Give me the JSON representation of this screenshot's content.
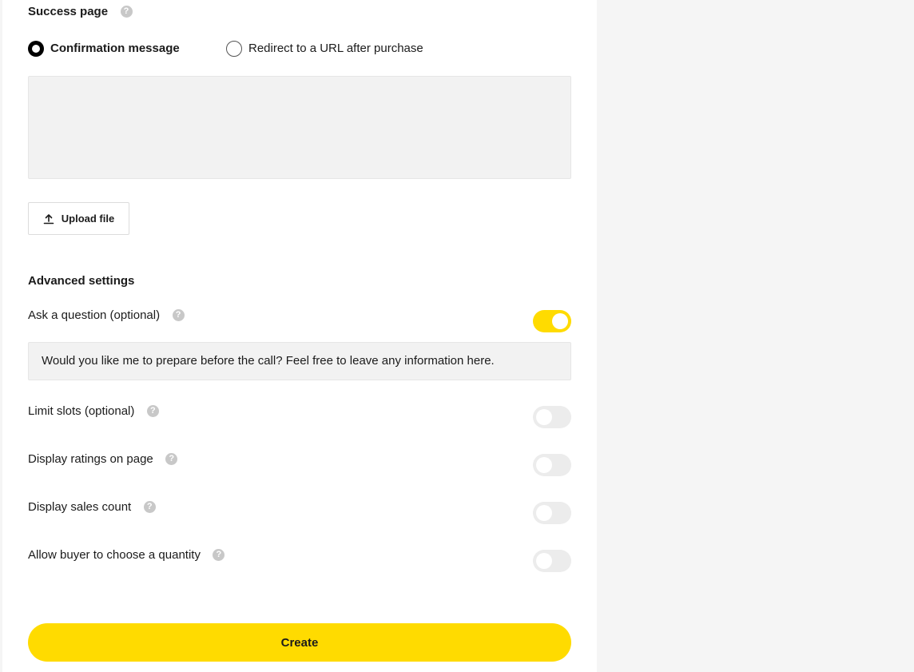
{
  "success_page": {
    "title": "Success page",
    "help_icon": "question-circle-icon",
    "options": [
      {
        "label": "Confirmation message",
        "selected": true
      },
      {
        "label": "Redirect to a URL after purchase",
        "selected": false
      }
    ],
    "message_value": "",
    "upload_label": "Upload file",
    "upload_icon": "upload-icon"
  },
  "advanced": {
    "title": "Advanced settings",
    "settings": [
      {
        "label": "Ask a question (optional)",
        "enabled": true
      },
      {
        "label": "Limit slots (optional)",
        "enabled": false
      },
      {
        "label": "Display ratings on page",
        "enabled": false
      },
      {
        "label": "Display sales count",
        "enabled": false
      },
      {
        "label": "Allow buyer to choose a quantity",
        "enabled": false
      }
    ],
    "question_value": "Would you like me to prepare before the call? Feel free to leave any information here."
  },
  "create_label": "Create",
  "colors": {
    "accent": "#ffdb00",
    "toggle_off": "#ececec",
    "input_bg": "#f2f2f2"
  }
}
